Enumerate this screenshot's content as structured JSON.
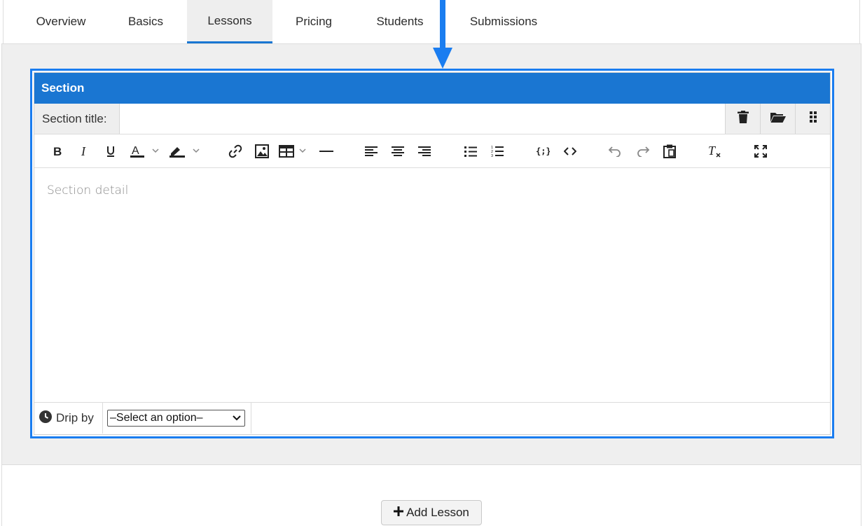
{
  "tabs": [
    {
      "label": "Overview"
    },
    {
      "label": "Basics"
    },
    {
      "label": "Lessons",
      "active": true
    },
    {
      "label": "Pricing"
    },
    {
      "label": "Students"
    },
    {
      "label": "Submissions"
    }
  ],
  "section": {
    "header": "Section",
    "title_label": "Section title:",
    "title_value": "",
    "actions": [
      "trash-icon",
      "folder-open-icon",
      "drag-handle-icon"
    ],
    "editor_placeholder": "Section detail",
    "drip_label": "Drip by",
    "drip_selected": "–Select an option–"
  },
  "toolbar": [
    "bold",
    "italic",
    "underline",
    "text-color",
    "highlight-color",
    "link",
    "image",
    "table",
    "horizontal-rule",
    "align-left",
    "align-center",
    "align-right",
    "bullet-list",
    "numbered-list",
    "code-sample",
    "source-code",
    "undo",
    "redo",
    "paste",
    "clear-formatting",
    "fullscreen"
  ],
  "add_lesson_label": "Add Lesson",
  "colors": {
    "accent": "#1a76d2",
    "highlight_border": "#1a7df0",
    "panel_bg": "#efefef"
  }
}
